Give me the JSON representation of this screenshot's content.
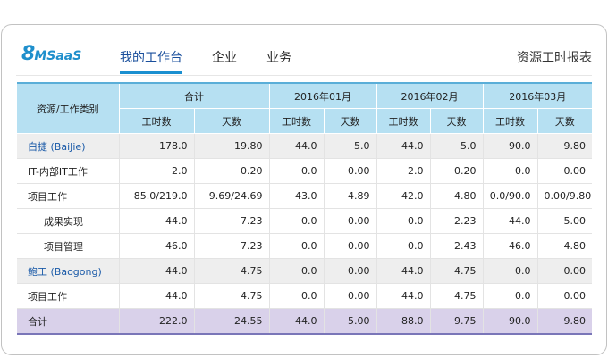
{
  "header": {
    "logo_big": "8",
    "logo_small": "MSaaS",
    "nav": [
      "我的工作台",
      "企业",
      "业务"
    ],
    "report_title": "资源工时报表"
  },
  "table": {
    "row_header": "资源/工作类别",
    "groups": [
      "合计",
      "2016年01月",
      "2016年02月",
      "2016年03月"
    ],
    "subheaders": [
      "工时数",
      "天数"
    ],
    "rows": [
      {
        "name": "白捷 (BaiJie)",
        "type": "group",
        "cells": [
          "178.0",
          "19.80",
          "44.0",
          "5.0",
          "44.0",
          "5.0",
          "90.0",
          "9.80"
        ]
      },
      {
        "name": "IT-内部IT工作",
        "type": "l1",
        "cells": [
          "2.0",
          "0.20",
          "0.0",
          "0.00",
          "2.0",
          "0.20",
          "0.0",
          "0.00"
        ]
      },
      {
        "name": "项目工作",
        "type": "l1",
        "cells": [
          "85.0/219.0",
          "9.69/24.69",
          "43.0",
          "4.89",
          "42.0",
          "4.80",
          "0.0/90.0",
          "0.00/9.80"
        ]
      },
      {
        "name": "成果实现",
        "type": "l2",
        "cells": [
          "44.0",
          "7.23",
          "0.0",
          "0.00",
          "0.0",
          "2.23",
          "44.0",
          "5.00"
        ]
      },
      {
        "name": "项目管理",
        "type": "l2",
        "cells": [
          "46.0",
          "7.23",
          "0.0",
          "0.00",
          "0.0",
          "2.43",
          "46.0",
          "4.80"
        ]
      },
      {
        "name": "鲍工 (Baogong)",
        "type": "group",
        "cells": [
          "44.0",
          "4.75",
          "0.0",
          "0.00",
          "44.0",
          "4.75",
          "0.0",
          "0.00"
        ]
      },
      {
        "name": "项目工作",
        "type": "l1",
        "cells": [
          "44.0",
          "4.75",
          "0.0",
          "0.00",
          "44.0",
          "4.75",
          "0.0",
          "0.00"
        ]
      },
      {
        "name": "合计",
        "type": "total",
        "cells": [
          "222.0",
          "24.55",
          "44.0",
          "5.00",
          "88.0",
          "9.75",
          "90.0",
          "9.80"
        ]
      }
    ]
  }
}
